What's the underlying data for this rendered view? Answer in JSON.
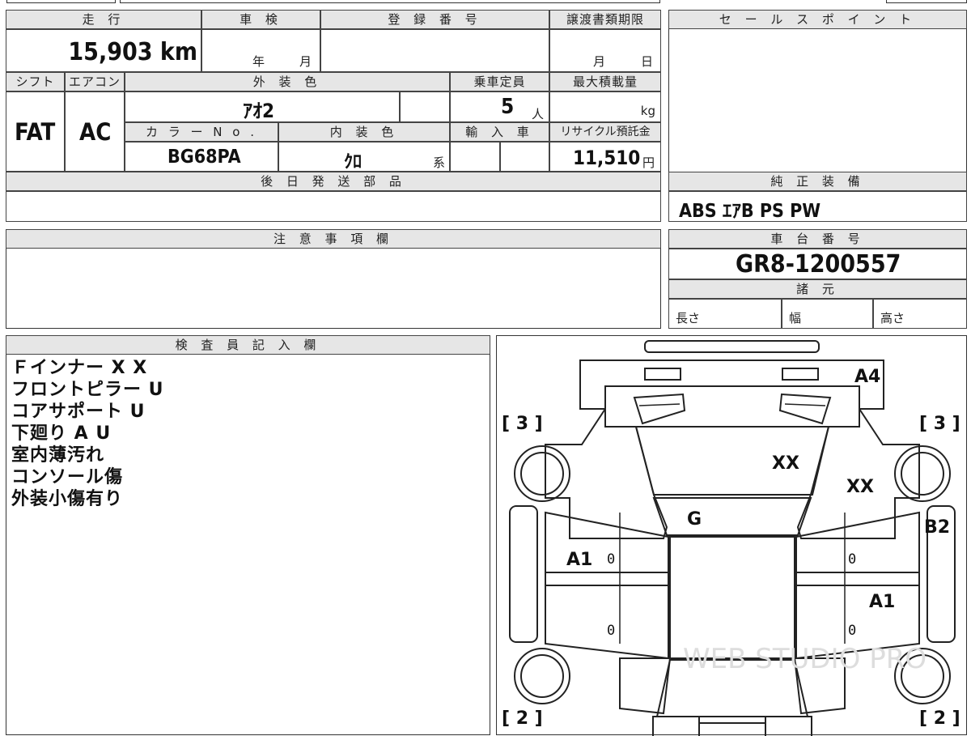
{
  "header": {
    "mileage_label": "走 行",
    "inspection_label": "車 検",
    "registration_label": "登 録 番 号",
    "transfer_deadline_label": "譲渡書類期限",
    "sales_point_label": "セ ー ル ス ポ イ ン ト"
  },
  "vehicle": {
    "mileage": "15,903 km",
    "inspection_year_unit": "年",
    "inspection_month_unit": "月",
    "deadline_month_unit": "月",
    "deadline_day_unit": "日",
    "shift_label": "シフト",
    "ac_label": "エアコン",
    "exterior_color_label": "外 装 色",
    "capacity_label": "乗車定員",
    "max_load_label": "最大積載量",
    "shift": "FAT",
    "ac": "AC",
    "exterior_color": "ｱｵ2",
    "capacity": "5",
    "capacity_unit": "人",
    "load_unit": "kg",
    "color_no_label": "カ ラ ー N o .",
    "interior_color_label": "内 装 色",
    "import_label": "輸 入 車",
    "recycle_label": "リサイクル預託金",
    "color_no": "BG68PA",
    "interior_color": "ｸﾛ",
    "interior_suffix": "系",
    "recycle_fee": "11,510",
    "yen_unit": "円",
    "later_parts_label": "後 日 発 送 部 品"
  },
  "equipment": {
    "label": "純 正 装 備",
    "value": "ABS ｴｱB PS PW"
  },
  "notes": {
    "label": "注 意 事 項 欄"
  },
  "chassis": {
    "label": "車 台 番 号",
    "value": "GR8-1200557",
    "spec_label": "諸 元",
    "length_label": "長さ",
    "width_label": "幅",
    "height_label": "高さ"
  },
  "inspector": {
    "label": "検 査 員 記 入 欄",
    "lines": [
      "Ｆインナー X X",
      "フロントピラー U",
      "コアサポート U",
      "下廻り A U",
      "室内薄汚れ",
      "コンソール傷",
      "外装小傷有り"
    ]
  },
  "diagram": {
    "tire_fl": "[ 3 ]",
    "tire_fr": "[ 3 ]",
    "tire_rl": "[ 2 ]",
    "tire_rr": "[ 2 ]",
    "marks": {
      "front_right": "A4",
      "hood": "XX",
      "right_fender": "XX",
      "windshield": "G",
      "right_step": "B2",
      "left_front_door": "A1",
      "right_rear_door": "A1",
      "left_front_door_num": "0",
      "left_rear_door_num": "0",
      "right_front_door_num": "0",
      "right_rear_door_num": "0"
    },
    "watermark": "WEB STUDIO PRO"
  }
}
